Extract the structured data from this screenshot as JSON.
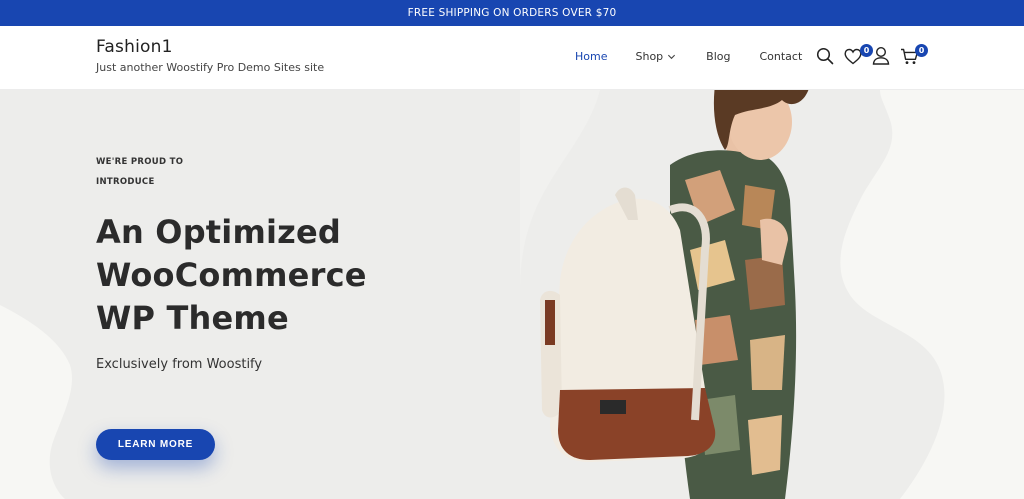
{
  "announcement": {
    "text": "FREE SHIPPING ON ORDERS OVER $70"
  },
  "site": {
    "title": "Fashion1",
    "tagline": "Just another Woostify Pro Demo Sites site"
  },
  "nav": {
    "items": [
      {
        "label": "Home"
      },
      {
        "label": "Shop"
      },
      {
        "label": "Blog"
      },
      {
        "label": "Contact"
      }
    ]
  },
  "header_icons": {
    "search": "search-icon",
    "wishlist": "heart-icon",
    "account": "user-icon",
    "cart": "cart-icon",
    "wishlist_count": "0",
    "cart_count": "0"
  },
  "hero": {
    "eyebrow_line1": "WE'RE PROUD TO",
    "eyebrow_line2": "INTRODUCE",
    "headline_line1": "An Optimized",
    "headline_line2": "WooCommerce",
    "headline_line3": "WP Theme",
    "subheadline": "Exclusively from Woostify",
    "cta_label": "LEARN MORE"
  },
  "colors": {
    "accent": "#1846b1",
    "hero_bg": "#ededeb",
    "text": "#2b2b2b"
  }
}
